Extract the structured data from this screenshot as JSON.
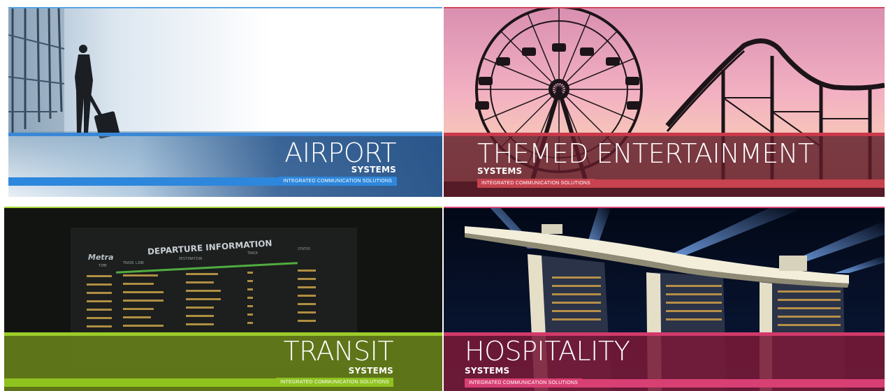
{
  "tiles": {
    "airport": {
      "title": "AIRPORT",
      "subtitle": "SYSTEMS",
      "tagline": "INTEGRATED COMMUNICATION SOLUTIONS",
      "accent": "#2d87dc",
      "photo": "traveler-with-suitcase-at-terminal-window"
    },
    "entertainment": {
      "title": "THEMED ENTERTAINMENT",
      "subtitle": "SYSTEMS",
      "tagline": "INTEGRATED COMMUNICATION SOLUTIONS",
      "accent": "#c8424f",
      "photo": "ferris-wheel-and-roller-coaster-at-sunset"
    },
    "transit": {
      "title": "TRANSIT",
      "subtitle": "SYSTEMS",
      "tagline": "INTEGRATED COMMUNICATION SOLUTIONS",
      "accent": "#8fc21f",
      "photo": "train-departure-board",
      "board": {
        "brand": "Metra",
        "heading": "DEPARTURE INFORMATION",
        "columns": [
          "TIME",
          "TRAIN LINE",
          "DESTINATION",
          "TRACK",
          "STATUS"
        ]
      }
    },
    "hospitality": {
      "title": "HOSPITALITY",
      "subtitle": "SYSTEMS",
      "tagline": "INTEGRATED COMMUNICATION SOLUTIONS",
      "accent": "#d83f72",
      "photo": "illuminated-hotel-towers-at-night"
    }
  }
}
